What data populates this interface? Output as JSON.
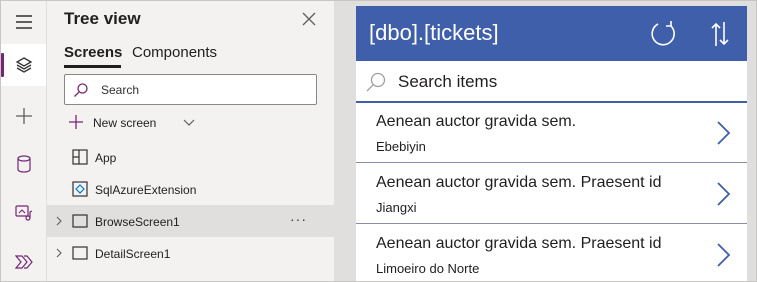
{
  "rail": {
    "items": [
      {
        "name": "menu-icon"
      },
      {
        "name": "tree-view-icon",
        "active": true
      },
      {
        "name": "insert-icon"
      },
      {
        "name": "data-icon"
      },
      {
        "name": "media-icon"
      },
      {
        "name": "power-automate-icon"
      }
    ]
  },
  "tree": {
    "title": "Tree view",
    "tabs": [
      {
        "label": "Screens",
        "active": true
      },
      {
        "label": "Components",
        "active": false
      }
    ],
    "search_placeholder": "Search",
    "new_screen_label": "New screen",
    "nodes": [
      {
        "label": "App",
        "icon": "app-icon",
        "expandable": false,
        "selected": false
      },
      {
        "label": "SqlAzureExtension",
        "icon": "component-icon",
        "expandable": false,
        "selected": false
      },
      {
        "label": "BrowseScreen1",
        "icon": "screen-icon",
        "expandable": true,
        "selected": true
      },
      {
        "label": "DetailScreen1",
        "icon": "screen-icon",
        "expandable": true,
        "selected": false
      }
    ],
    "more_label": "···"
  },
  "app": {
    "title": "[dbo].[tickets]",
    "search_placeholder": "Search items",
    "items": [
      {
        "title": "Aenean auctor gravida sem.",
        "subtitle": "Ebebiyin"
      },
      {
        "title": "Aenean auctor gravida sem. Praesent id",
        "subtitle": "Jiangxi"
      },
      {
        "title": "Aenean auctor gravida sem. Praesent id",
        "subtitle": "Limoeiro do Norte"
      }
    ]
  },
  "colors": {
    "header": "#3f5faa",
    "accent": "#742774",
    "pane_bg": "#f3f2f1",
    "canvas_bg": "#e1dfdd"
  }
}
